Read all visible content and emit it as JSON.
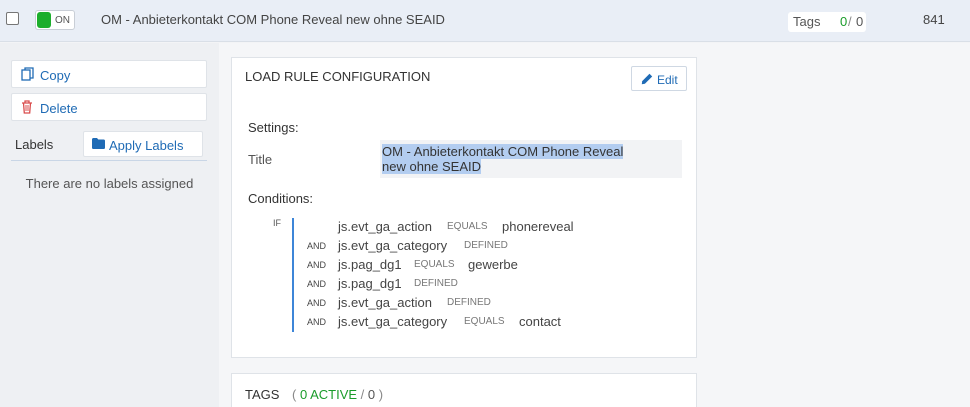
{
  "header": {
    "toggle_label": "ON",
    "rule_title": "OM - Anbieterkontakt COM Phone Reveal new ohne SEAID",
    "tags_label": "Tags",
    "tags_active": "0",
    "tags_sep": "/",
    "tags_total": "0",
    "rule_id": "841"
  },
  "sidebar": {
    "copy_label": "Copy",
    "delete_label": "Delete",
    "labels_label": "Labels",
    "apply_labels": "Apply Labels",
    "no_labels": "There are no labels assigned"
  },
  "config": {
    "panel_title": "LOAD RULE CONFIGURATION",
    "edit_label": "Edit",
    "settings_heading": "Settings:",
    "title_label": "Title",
    "title_line1": "OM - Anbieterkontakt COM Phone Reveal",
    "title_line2": "new ohne SEAID",
    "conditions_heading": "Conditions:",
    "if_label": "IF",
    "conditions": [
      {
        "op": "",
        "var": "js.evt_ga_action",
        "cmp": "EQUALS",
        "val": "phonereveal"
      },
      {
        "op": "AND",
        "var": "js.evt_ga_category",
        "cmp": "DEFINED",
        "val": ""
      },
      {
        "op": "AND",
        "var": "js.pag_dg1",
        "cmp": "EQUALS",
        "val": "gewerbe"
      },
      {
        "op": "AND",
        "var": "js.pag_dg1",
        "cmp": "DEFINED",
        "val": ""
      },
      {
        "op": "AND",
        "var": "js.evt_ga_action",
        "cmp": "DEFINED",
        "val": ""
      },
      {
        "op": "AND",
        "var": "js.evt_ga_category",
        "cmp": "EQUALS",
        "val": "contact"
      }
    ]
  },
  "tags_panel": {
    "title": "TAGS",
    "open_paren": "(",
    "active": "0 ACTIVE",
    "sep": "/",
    "total": "0",
    "close_paren": ")"
  },
  "colors": {
    "accent": "#1f6bb5",
    "toggle_on": "#1cae2c",
    "active_green": "#1a9c2a",
    "condition_bar": "#3d86d8",
    "selection": "#b3cdf0"
  }
}
